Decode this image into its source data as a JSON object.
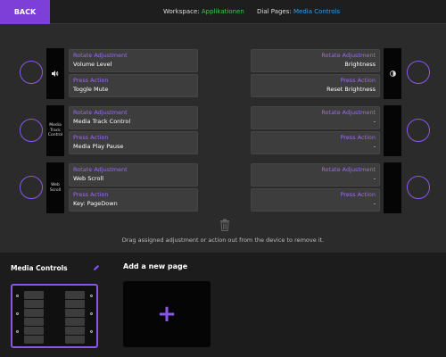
{
  "header": {
    "back_label": "BACK",
    "workspace_label": "Workspace:",
    "workspace_value": "Applikationen",
    "dialpages_label": "Dial Pages:",
    "dialpages_value": "Media Controls"
  },
  "dials": [
    {
      "side": "left",
      "strip_text": "",
      "strip_icon": "speaker-icon",
      "rotate_label": "Rotate Adjustment",
      "rotate_value": "Volume Level",
      "press_label": "Press Action",
      "press_value": "Toggle Mute"
    },
    {
      "side": "left",
      "strip_text": "Media Track Control",
      "rotate_label": "Rotate Adjustment",
      "rotate_value": "Media Track Control",
      "press_label": "Press Action",
      "press_value": "Media Play Pause"
    },
    {
      "side": "left",
      "strip_text": "Web Scroll",
      "rotate_label": "Rotate Adjustment",
      "rotate_value": "Web Scroll",
      "press_label": "Press Action",
      "press_value": "Key: PageDown"
    },
    {
      "side": "right",
      "strip_text": "",
      "strip_icon": "brightness-icon",
      "rotate_label": "Rotate Adjustment",
      "rotate_value": "Brightness",
      "press_label": "Press Action",
      "press_value": "Reset Brightness"
    },
    {
      "side": "right",
      "strip_text": "",
      "rotate_label": "Rotate Adjustment",
      "rotate_value": "-",
      "press_label": "Press Action",
      "press_value": "-"
    },
    {
      "side": "right",
      "strip_text": "",
      "rotate_label": "Rotate Adjustment",
      "rotate_value": "-",
      "press_label": "Press Action",
      "press_value": "-"
    }
  ],
  "hint": "Drag assigned adjustment or action out from the device to remove it.",
  "pages": {
    "current_name": "Media Controls",
    "add_label": "Add a new page",
    "add_symbol": "+"
  },
  "colors": {
    "accent": "#7d3fd8",
    "workspace_green": "#3cc84a",
    "dialpage_blue": "#2f9ef0"
  }
}
